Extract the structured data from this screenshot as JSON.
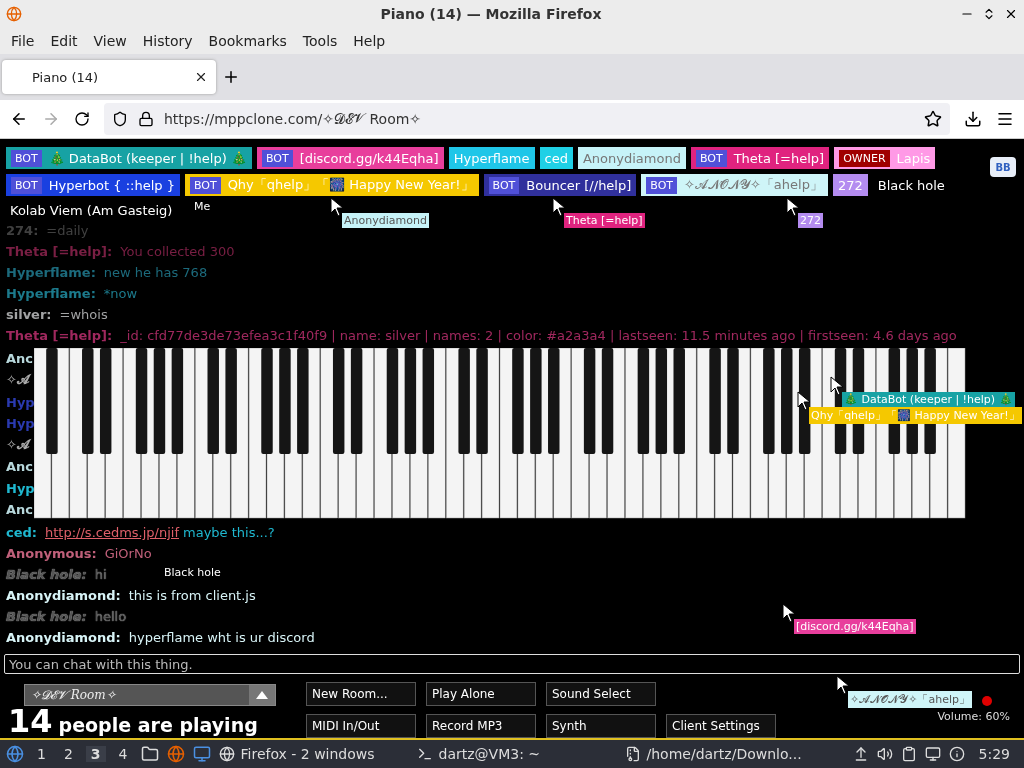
{
  "window": {
    "title": "Piano (14) — Mozilla Firefox"
  },
  "menu": [
    "File",
    "Edit",
    "View",
    "History",
    "Bookmarks",
    "Tools",
    "Help"
  ],
  "tabs": [
    {
      "label": "Piano (14)",
      "selected": true
    }
  ],
  "address": {
    "value": "https://mppclone.com/✧𝓓𝓔𝓥 Room✧"
  },
  "user_rows": [
    [
      {
        "badge": "BOT",
        "name": "🎄 DataBot (keeper | !help) 🎄",
        "color": "#17a2a4"
      },
      {
        "badge": "BOT",
        "name": "[discord.gg/k44Eqha]",
        "color": "#e83e9c"
      },
      {
        "name": "Hyperflame",
        "color": "#1fc6e8"
      },
      {
        "name": "ced",
        "color": "#1fd0e6"
      },
      {
        "name": "Anonydiamond",
        "color": "#c6f3f8"
      },
      {
        "badge": "BOT",
        "name": "Theta [=help]",
        "color": "#e0237f"
      },
      {
        "badge": "OWNER",
        "name": "Lapis",
        "color": "#ff99e6"
      }
    ],
    [
      {
        "badge": "BOT",
        "name": "Hyperbot { ::help }",
        "color": "#1a40e0"
      },
      {
        "badge": "BOT",
        "name": "Qhy「qhelp」「🎆 Happy New Year!」",
        "color": "#f5c800"
      },
      {
        "badge": "BOT",
        "name": "Bouncer [//help]",
        "color": "#30309c"
      },
      {
        "badge": "BOT",
        "name": "✧𝓐𝓝𝓞𝓝𝓨✧「ahelp」",
        "color": "#cff5f8"
      },
      {
        "name": "272",
        "color": "#b48cf0"
      },
      {
        "name": "Black hole",
        "color": "#000000"
      }
    ]
  ],
  "bb_label": "BB",
  "room_label": "Kolab Viem (Am Gasteig)",
  "chat_top": [
    {
      "name": "274:",
      "text": "=daily",
      "color": "#404040"
    },
    {
      "name": "Theta [=help]:",
      "text": "You collected 300",
      "color": "#7a1f44"
    },
    {
      "name": "Hyperflame:",
      "text": "new he has 768",
      "color": "#1c6a7c"
    },
    {
      "name": "Hyperflame:",
      "text": "*now",
      "color": "#1c7a8c"
    },
    {
      "name": "silver:",
      "text": "=whois",
      "color": "#a2a3a4"
    },
    {
      "name": "Theta [=help]:",
      "text": "_id: cfd77de3de73efea3c1f40f9 | name: silver | names: 2 | color: #a2a3a4 | lastseen: 11.5 minutes ago | firstseen: 4.6 days ago",
      "color": "#a0285e"
    }
  ],
  "chat_hidden": [
    {
      "name": "Anc",
      "color": "#b8d8dc"
    },
    {
      "name": "✧𝓐",
      "color": "#aaaaaa"
    },
    {
      "name": "Hyp",
      "color": "#2a3ab0"
    },
    {
      "name": "Hyp",
      "color": "#2a3ab0"
    },
    {
      "name": "✧𝓐",
      "color": "#aaaaaa"
    },
    {
      "name": "Anc",
      "color": "#b8d8dc"
    },
    {
      "name": "Hyp",
      "color": "#1fb8d0"
    },
    {
      "name": "Anc",
      "color": "#b8d8dc"
    }
  ],
  "chat_bottom": [
    {
      "kind": "link",
      "name": "ced:",
      "link": "http://s.cedms.jp/njif",
      "text": "maybe this...?",
      "color": "#1fb8d0"
    },
    {
      "kind": "plain",
      "name": "Anonymous:",
      "text": "GiOrNo",
      "color": "#c0607a"
    },
    {
      "kind": "outlined",
      "name": "Black hole:",
      "text": "hi",
      "color": "#555555"
    },
    {
      "kind": "plain",
      "name": "Anonydiamond:",
      "text": "this is from client.js",
      "color": "#d8f4f7"
    },
    {
      "kind": "outlined",
      "name": "Black hole:",
      "text": "hello",
      "color": "#555555"
    },
    {
      "kind": "plain",
      "name": "Anonydiamond:",
      "text": "hyperflame wht is ur discord",
      "color": "#d8f4f7"
    }
  ],
  "chat_input": {
    "placeholder": "You can chat with this thing."
  },
  "cursors": [
    {
      "label": "Me",
      "color": "#000000"
    },
    {
      "label": "Anonydiamond",
      "color": "#c6f3f8"
    },
    {
      "label": "Theta [=help]",
      "color": "#e0237f"
    },
    {
      "label": "272",
      "color": "#b48cf0"
    },
    {
      "label": "🎄 DataBot (keeper | !help) 🎄",
      "color": "#17a2a4"
    },
    {
      "label": "Qhy「qhelp」「🎆 Happy New Year!」",
      "color": "#f5c800"
    },
    {
      "label": "Black hole",
      "color": "#000000"
    },
    {
      "label": "[discord.gg/k44Eqha]",
      "color": "#e83e9c"
    },
    {
      "label": "✧𝓐𝓝𝓞𝓝𝓨✧「ahelp」",
      "color": "#cff5f8"
    }
  ],
  "room_select": "✧𝓓𝓔𝓥 Room✧",
  "player_count": "14",
  "player_text": "people are playing",
  "buttons": [
    [
      "New Room...",
      "Play Alone",
      "Sound Select"
    ],
    [
      "MIDI In/Out",
      "Record MP3",
      "Synth",
      "Client Settings"
    ]
  ],
  "volume": "Volume: 60%",
  "taskbar": {
    "workspaces": [
      {
        "label": "1",
        "selected": false
      },
      {
        "label": "2",
        "selected": false
      },
      {
        "label": "3",
        "selected": true
      },
      {
        "label": "4",
        "selected": false
      }
    ],
    "tasks": [
      "Firefox - 2 windows",
      "dartz@VM3: ~",
      "/home/dartz/Downlo..."
    ],
    "time": "5:29"
  }
}
